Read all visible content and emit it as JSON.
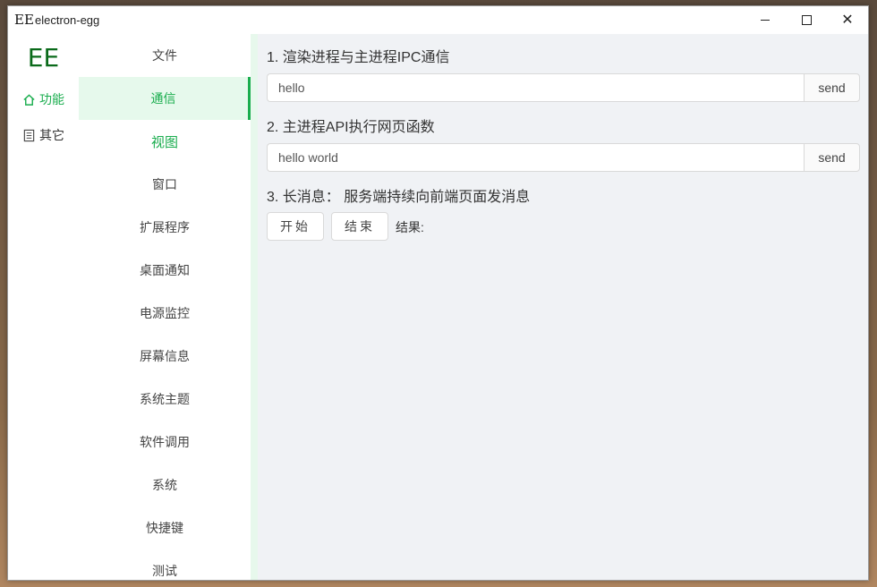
{
  "window": {
    "app_icon_text": "EE",
    "title": "electron-egg"
  },
  "rail": {
    "logo": "EE",
    "items": [
      {
        "label": "功能",
        "icon": "home-icon",
        "active": true
      },
      {
        "label": "其它",
        "icon": "document-icon",
        "active": false
      }
    ]
  },
  "submenu": {
    "items": [
      "文件",
      "通信",
      "视图",
      "窗口",
      "扩展程序",
      "桌面通知",
      "电源监控",
      "屏幕信息",
      "系统主题",
      "软件调用",
      "系统",
      "快捷键",
      "测试"
    ],
    "selected": "通信",
    "highlighted": "视图"
  },
  "content": {
    "section1": {
      "title": "1. 渲染进程与主进程IPC通信",
      "input_value": "hello",
      "button": "send"
    },
    "section2": {
      "title": "2. 主进程API执行网页函数",
      "input_value": "hello world",
      "button": "send"
    },
    "section3": {
      "title": "3. 长消息：  服务端持续向前端页面发消息",
      "start_button": "开始",
      "stop_button": "结束",
      "result_label": "结果:"
    }
  },
  "colors": {
    "accent": "#1aad4e",
    "logo": "#0a6a1a",
    "content_bg": "#f0f2f5"
  }
}
